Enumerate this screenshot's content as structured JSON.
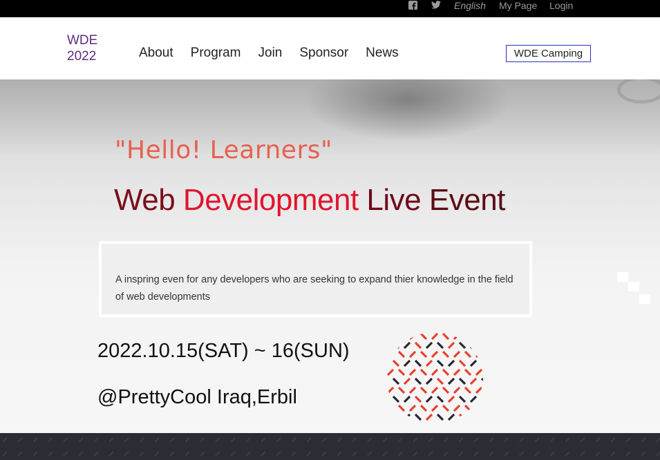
{
  "topbar": {
    "facebook_icon": "facebook-icon",
    "twitter_icon": "twitter-icon",
    "language": "English",
    "my_page": "My Page",
    "login": "Login"
  },
  "header": {
    "logo_line1": "WDE",
    "logo_line2": "2022",
    "nav": [
      {
        "label": "About"
      },
      {
        "label": "Program"
      },
      {
        "label": "Join"
      },
      {
        "label": "Sponsor"
      },
      {
        "label": "News"
      }
    ],
    "camping_button": "WDE Camping"
  },
  "hero": {
    "greeting": "\"Hello! Learners\"",
    "title_words": [
      "Web",
      "Development",
      "Live",
      "Event"
    ],
    "description": "A inspring even for any developers who are seeking to expand thier knowledge in the field of web developments",
    "date": "2022.10.15(SAT) ~ 16(SUN)",
    "venue": "@PrettyCool Iraq,Erbil"
  },
  "colors": {
    "logo": "#5a2d82",
    "greeting": "#e8604f",
    "title_dark": "#7a0f1c",
    "title_red": "#e0152e",
    "pattern_red": "#e8402e",
    "pattern_dark": "#2a2633",
    "footer_band": "#2c2c35"
  }
}
